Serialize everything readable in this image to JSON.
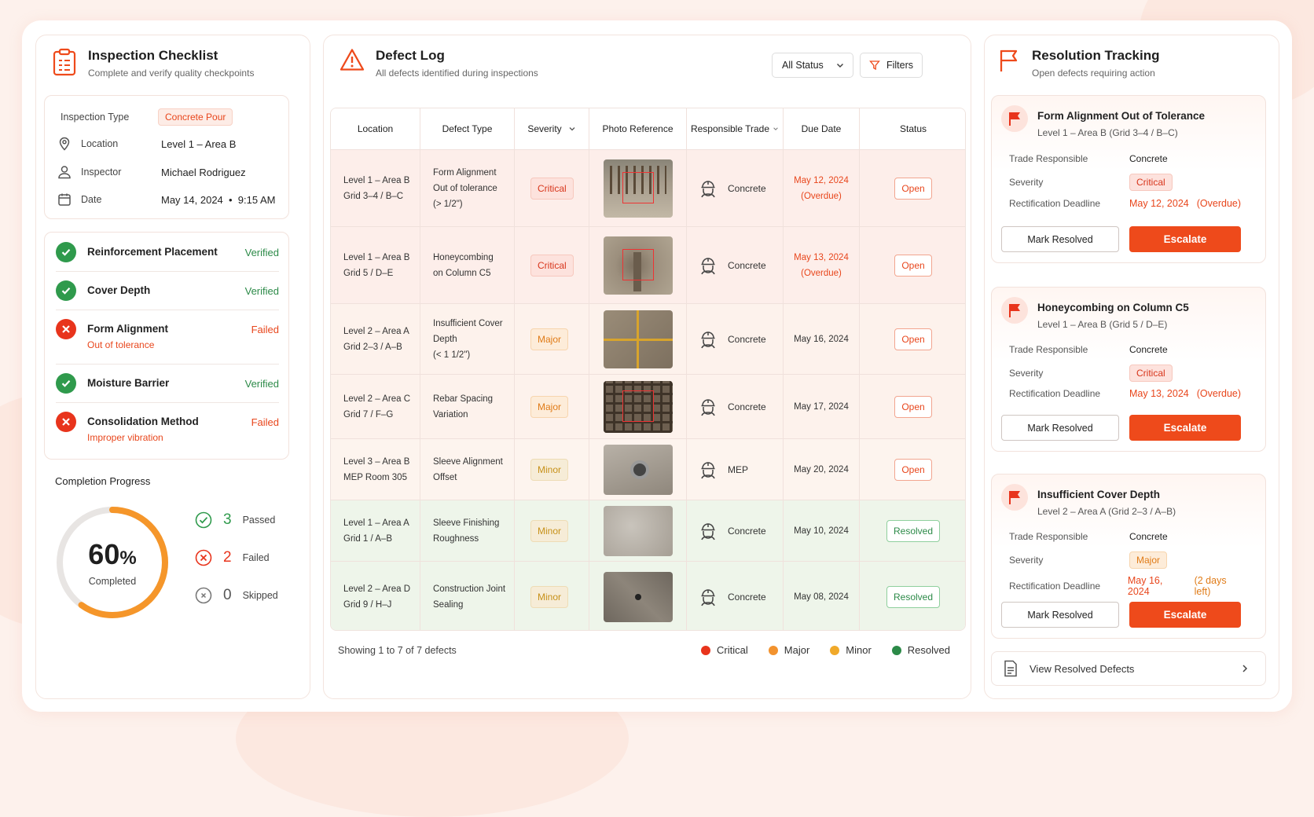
{
  "checklist": {
    "title": "Inspection Checklist",
    "subtitle": "Complete and verify quality checkpoints",
    "info": {
      "type_label": "Inspection Type",
      "type_value": "Concrete Pour",
      "location_label": "Location",
      "location_value": "Level 1 – Area B",
      "inspector_label": "Inspector",
      "inspector_value": "Michael Rodriguez",
      "date_label": "Date",
      "date_value": "May 14, 2024  •  9:15 AM"
    },
    "items": [
      {
        "name": "Reinforcement Placement",
        "status": "Verified",
        "note": ""
      },
      {
        "name": "Cover Depth",
        "status": "Verified",
        "note": ""
      },
      {
        "name": "Form Alignment",
        "status": "Failed",
        "note": "Out of tolerance"
      },
      {
        "name": "Moisture Barrier",
        "status": "Verified",
        "note": ""
      },
      {
        "name": "Consolidation Method",
        "status": "Failed",
        "note": "Improper vibration"
      }
    ],
    "progress": {
      "title": "Completion Progress",
      "percent_value": "60",
      "percent_sign": "%",
      "percent_fraction": 0.6,
      "caption": "Completed",
      "passed_count": "3",
      "passed_label": "Passed",
      "failed_count": "2",
      "failed_label": "Failed",
      "skipped_count": "0",
      "skipped_label": "Skipped"
    }
  },
  "defects": {
    "title": "Defect Log",
    "subtitle": "All defects identified during inspections",
    "status_filter": "All Status",
    "filters_label": "Filters",
    "columns": [
      "Location",
      "Defect Type",
      "Severity",
      "Photo Reference",
      "Responsible Trade",
      "Due Date",
      "Status"
    ],
    "rows": [
      {
        "loc1": "Level 1 – Area B",
        "loc2": "Grid 3–4 / B–C",
        "type": [
          "Form Alignment",
          "Out of tolerance",
          "(> 1/2\")"
        ],
        "severity": "Critical",
        "trade": "Concrete",
        "due1": "May 12, 2024",
        "due2": "(Overdue)",
        "status": "Open"
      },
      {
        "loc1": "Level 1 – Area B",
        "loc2": "Grid 5 / D–E",
        "type": [
          "Honeycombing",
          "on Column C5"
        ],
        "severity": "Critical",
        "trade": "Concrete",
        "due1": "May 13, 2024",
        "due2": "(Overdue)",
        "status": "Open"
      },
      {
        "loc1": "Level 2 – Area A",
        "loc2": "Grid 2–3 / A–B",
        "type": [
          "Insufficient Cover",
          "Depth",
          "(< 1 1/2\")"
        ],
        "severity": "Major",
        "trade": "Concrete",
        "due1": "May 16, 2024",
        "due2": "",
        "status": "Open"
      },
      {
        "loc1": "Level 2 – Area C",
        "loc2": "Grid 7 / F–G",
        "type": [
          "Rebar Spacing",
          "Variation"
        ],
        "severity": "Major",
        "trade": "Concrete",
        "due1": "May 17, 2024",
        "due2": "",
        "status": "Open"
      },
      {
        "loc1": "Level 3 – Area B",
        "loc2": "MEP Room 305",
        "type": [
          "Sleeve Alignment",
          "Offset"
        ],
        "severity": "Minor",
        "trade": "MEP",
        "due1": "May 20, 2024",
        "due2": "",
        "status": "Open"
      },
      {
        "loc1": "Level 1 – Area A",
        "loc2": "Grid 1 / A–B",
        "type": [
          "Sleeve Finishing",
          "Roughness"
        ],
        "severity": "Minor",
        "trade": "Concrete",
        "due1": "May 10, 2024",
        "due2": "",
        "status": "Resolved"
      },
      {
        "loc1": "Level 2 – Area D",
        "loc2": "Grid 9 / H–J",
        "type": [
          "Construction Joint",
          "Sealing"
        ],
        "severity": "Minor",
        "trade": "Concrete",
        "due1": "May 08, 2024",
        "due2": "",
        "status": "Resolved"
      }
    ],
    "footer": "Showing 1 to 7 of 7 defects",
    "legend": [
      "Critical",
      "Major",
      "Minor",
      "Resolved"
    ]
  },
  "resolution": {
    "title": "Resolution Tracking",
    "subtitle": "Open defects requiring action",
    "labels": {
      "trade": "Trade Responsible",
      "severity": "Severity",
      "deadline": "Rectification Deadline"
    },
    "mark_label": "Mark Resolved",
    "escalate_label": "Escalate",
    "cards": [
      {
        "title": "Form Alignment Out of Tolerance",
        "loc": "Level 1 – Area B (Grid 3–4 / B–C)",
        "trade": "Concrete",
        "severity": "Critical",
        "deadline": "May 12, 2024",
        "note": "(Overdue)"
      },
      {
        "title": "Honeycombing on Column C5",
        "loc": "Level 1 – Area B (Grid 5 / D–E)",
        "trade": "Concrete",
        "severity": "Critical",
        "deadline": "May 13, 2024",
        "note": "(Overdue)"
      },
      {
        "title": "Insufficient Cover Depth",
        "loc": "Level 2 – Area A (Grid 2–3 / A–B)",
        "trade": "Concrete",
        "severity": "Major",
        "deadline": "May 16, 2024",
        "note": "(2 days left)"
      }
    ],
    "view_resolved": "View Resolved Defects"
  },
  "colors": {
    "accent": "#ee4a1b",
    "critical": "#e8341c",
    "major": "#f2922e",
    "minor": "#f0a92a",
    "resolved": "#2c8a48"
  }
}
